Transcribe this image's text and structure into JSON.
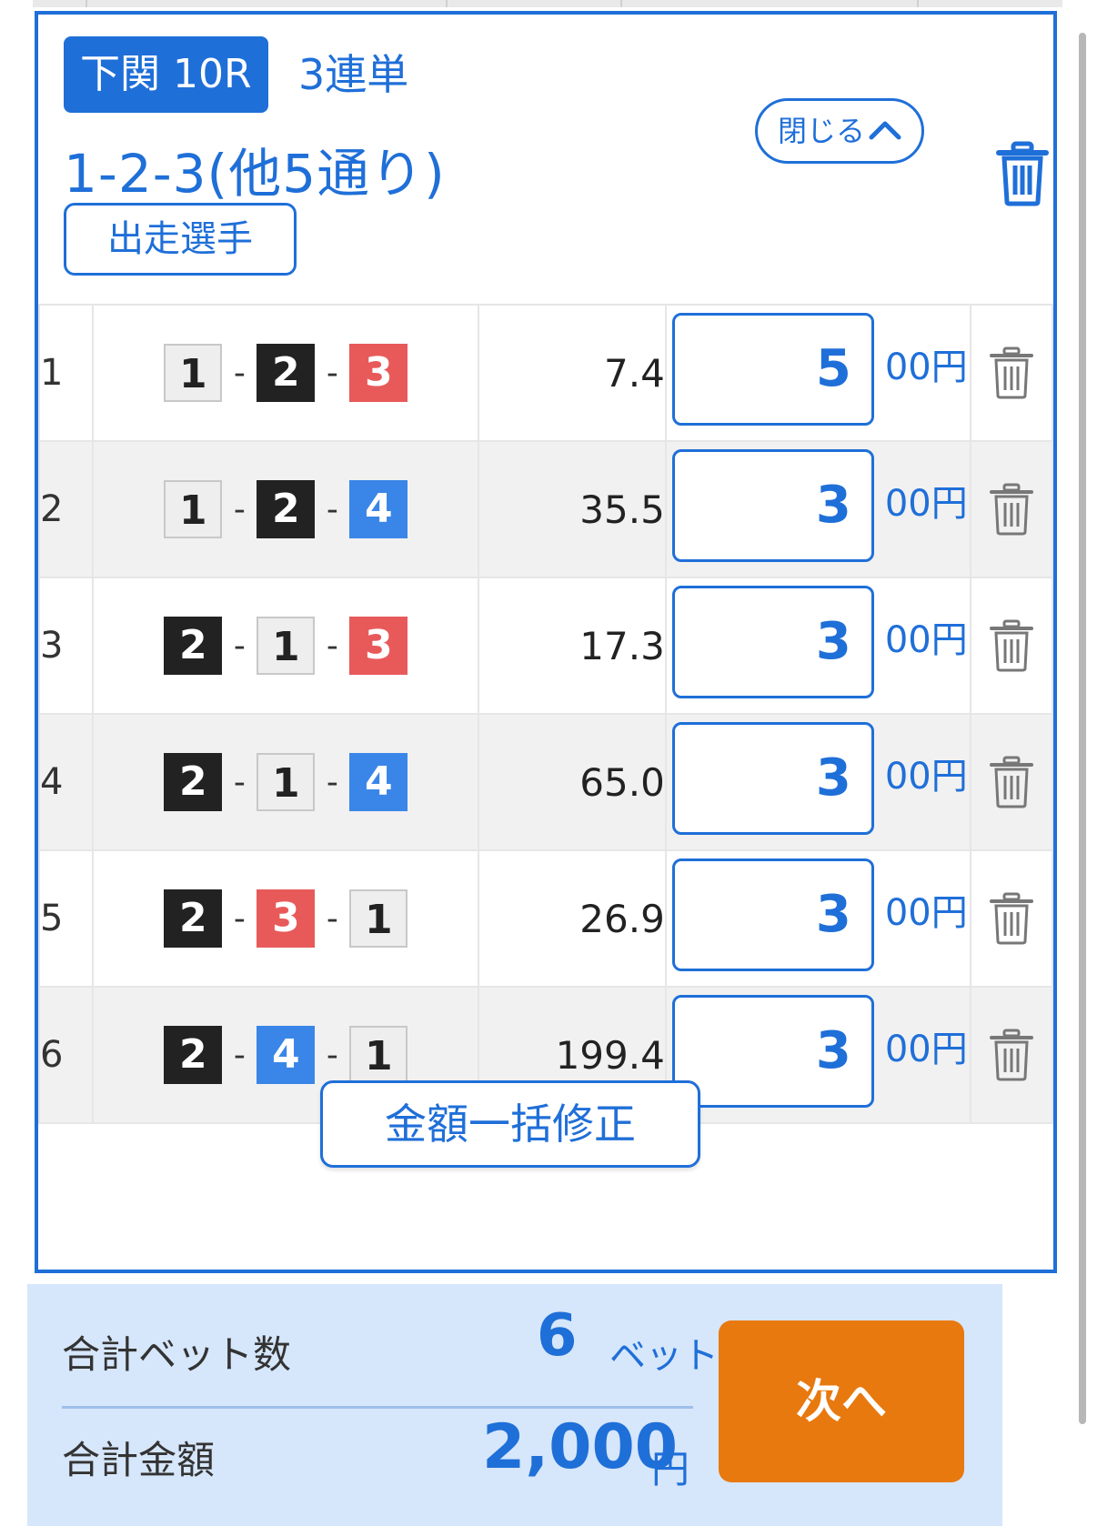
{
  "ticket": {
    "venue_race": "下関 10R",
    "bet_type": "3連単",
    "combo_summary": "1-2-3(他5通り)",
    "players_button": "出走選手",
    "close_button": "閉じる",
    "close_icon": "chevron-up-icon",
    "delete_icon": "trash-icon"
  },
  "row_colors": {
    "1": "#eeeeee",
    "2": "#222222",
    "3": "#e85a5a",
    "4": "#3a86e8"
  },
  "rows": [
    {
      "no": "1",
      "combo": [
        "1",
        "2",
        "3"
      ],
      "odds": "7.4",
      "amount": "5",
      "suffix": "00円"
    },
    {
      "no": "2",
      "combo": [
        "1",
        "2",
        "4"
      ],
      "odds": "35.5",
      "amount": "3",
      "suffix": "00円"
    },
    {
      "no": "3",
      "combo": [
        "2",
        "1",
        "3"
      ],
      "odds": "17.3",
      "amount": "3",
      "suffix": "00円"
    },
    {
      "no": "4",
      "combo": [
        "2",
        "1",
        "4"
      ],
      "odds": "65.0",
      "amount": "3",
      "suffix": "00円"
    },
    {
      "no": "5",
      "combo": [
        "2",
        "3",
        "1"
      ],
      "odds": "26.9",
      "amount": "3",
      "suffix": "00円"
    },
    {
      "no": "6",
      "combo": [
        "2",
        "4",
        "1"
      ],
      "odds": "199.4",
      "amount": "3",
      "suffix": "00円"
    }
  ],
  "bulk_edit_button": "金額一括修正",
  "footer": {
    "total_bets_label": "合計ベット数",
    "total_bets_value": "6",
    "total_bets_unit": "ベット",
    "total_amount_label": "合計金額",
    "total_amount_value": "2,000",
    "total_amount_unit": "円",
    "next_button": "次へ",
    "accent_color": "#e8790f"
  }
}
